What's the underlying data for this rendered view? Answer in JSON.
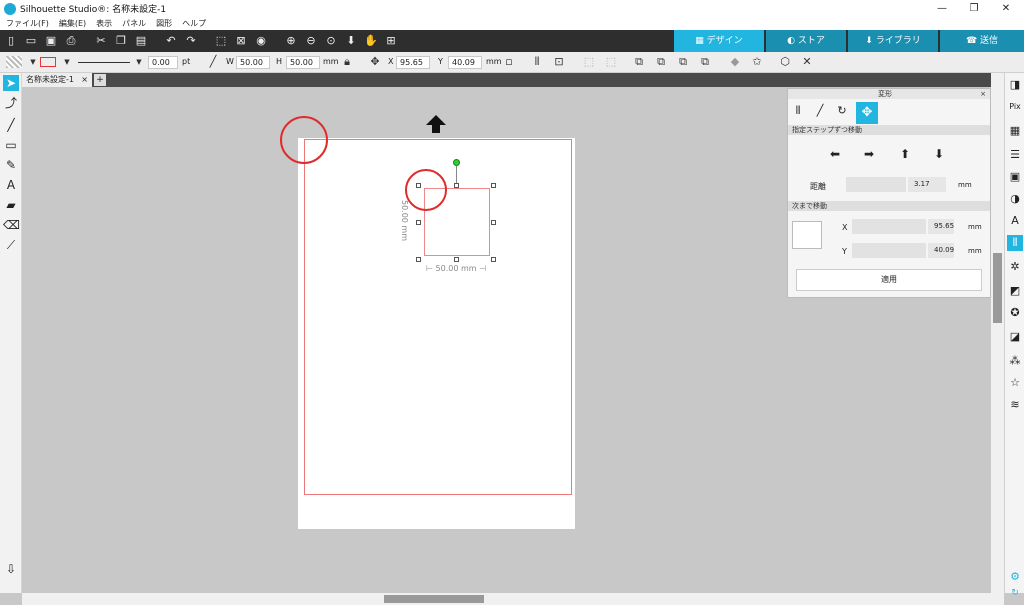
{
  "window": {
    "title": "Silhouette Studio®: 名称未設定-1",
    "minimize": "—",
    "maximize": "❐",
    "close": "✕"
  },
  "menu": [
    "ファイル(F)",
    "編集(E)",
    "表示",
    "パネル",
    "図形",
    "ヘルプ"
  ],
  "nav_tabs": {
    "design": "デザイン",
    "store": "ストア",
    "library": "ライブラリ",
    "send": "送信"
  },
  "toolbar": {
    "line_width_value": "0.00",
    "line_width_unit": "pt",
    "w_label": "W",
    "w_value": "50.00",
    "h_label": "H",
    "h_value": "50.00",
    "size_unit": "mm",
    "x_label": "X",
    "x_value": "95.65",
    "y_label": "Y",
    "y_value": "40.09",
    "pos_unit": "mm"
  },
  "document": {
    "tab_label": "名称未設定-1",
    "close": "×",
    "add": "+"
  },
  "selection": {
    "width_label": "50.00 mm",
    "height_label": "50.00 mm"
  },
  "transform_panel": {
    "title": "変形",
    "section_step": "指定ステップずつ移動",
    "distance_label": "距離",
    "distance_value": "3.17",
    "distance_unit": "mm",
    "section_move_to": "次まで移動",
    "x_label": "X",
    "x_value": "95.65",
    "x_unit": "mm",
    "y_label": "Y",
    "y_value": "40.09",
    "y_unit": "mm",
    "apply_button": "適用"
  },
  "colors": {
    "accent": "#22b5df",
    "cut_line": "#e77777",
    "annotation_circle": "#e02b2b"
  }
}
